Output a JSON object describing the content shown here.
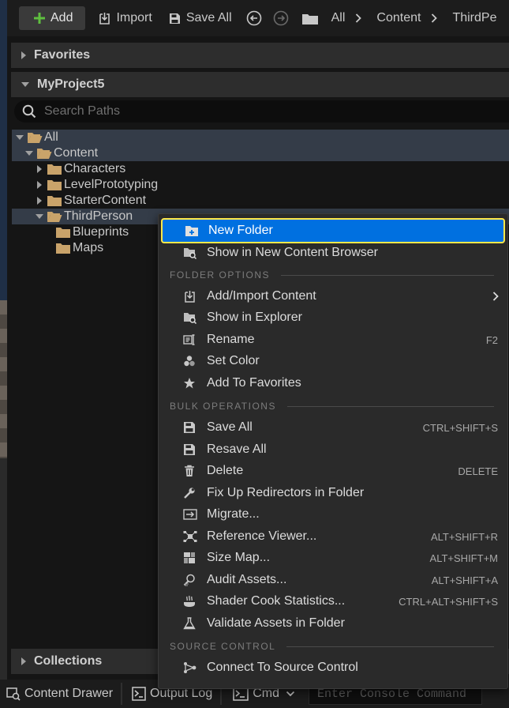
{
  "toolbar": {
    "add_label": "Add",
    "import_label": "Import",
    "save_all_label": "Save All",
    "breadcrumb": [
      "All",
      "Content",
      "ThirdPe"
    ]
  },
  "panel": {
    "favorites_label": "Favorites",
    "project_label": "MyProject5",
    "search_placeholder": "Search Paths",
    "collections_label": "Collections"
  },
  "tree": [
    {
      "label": "All",
      "depth": 0,
      "expanded": true,
      "selected": true
    },
    {
      "label": "Content",
      "depth": 1,
      "expanded": true,
      "selected": true
    },
    {
      "label": "Characters",
      "depth": 2,
      "expanded": false
    },
    {
      "label": "LevelPrototyping",
      "depth": 2,
      "expanded": false
    },
    {
      "label": "StarterContent",
      "depth": 2,
      "expanded": false
    },
    {
      "label": "ThirdPerson",
      "depth": 2,
      "expanded": true,
      "selected": true
    },
    {
      "label": "Blueprints",
      "depth": 3,
      "leaf": true
    },
    {
      "label": "Maps",
      "depth": 3,
      "leaf": true
    }
  ],
  "context_menu": {
    "items": [
      {
        "label": "New Folder",
        "icon": "new-folder-icon",
        "shortcut": "",
        "highlight": true
      },
      {
        "label": "Show in New Content Browser",
        "icon": "folder-search-icon",
        "shortcut": ""
      },
      {
        "section": "FOLDER OPTIONS"
      },
      {
        "label": "Add/Import Content",
        "icon": "import-icon",
        "shortcut": "",
        "submenu": true
      },
      {
        "label": "Show in Explorer",
        "icon": "folder-search-icon",
        "shortcut": ""
      },
      {
        "label": "Rename",
        "icon": "rename-icon",
        "shortcut": "F2"
      },
      {
        "label": "Set Color",
        "icon": "color-icon",
        "shortcut": ""
      },
      {
        "label": "Add To Favorites",
        "icon": "star-icon",
        "shortcut": ""
      },
      {
        "section": "BULK OPERATIONS"
      },
      {
        "label": "Save All",
        "icon": "save-icon",
        "shortcut": "CTRL+SHIFT+S"
      },
      {
        "label": "Resave All",
        "icon": "save-icon",
        "shortcut": ""
      },
      {
        "label": "Delete",
        "icon": "trash-icon",
        "shortcut": "DELETE"
      },
      {
        "label": "Fix Up Redirectors in Folder",
        "icon": "wrench-icon",
        "shortcut": ""
      },
      {
        "label": "Migrate...",
        "icon": "migrate-icon",
        "shortcut": ""
      },
      {
        "label": "Reference Viewer...",
        "icon": "reference-icon",
        "shortcut": "ALT+SHIFT+R"
      },
      {
        "label": "Size Map...",
        "icon": "size-map-icon",
        "shortcut": "ALT+SHIFT+M"
      },
      {
        "label": "Audit Assets...",
        "icon": "audit-icon",
        "shortcut": "ALT+SHIFT+A"
      },
      {
        "label": "Shader Cook Statistics...",
        "icon": "shader-icon",
        "shortcut": "CTRL+ALT+SHIFT+S"
      },
      {
        "label": "Validate Assets in Folder",
        "icon": "flask-icon",
        "shortcut": ""
      },
      {
        "section": "SOURCE CONTROL"
      },
      {
        "label": "Connect To Source Control",
        "icon": "source-control-icon",
        "shortcut": ""
      }
    ]
  },
  "bottombar": {
    "content_drawer_label": "Content Drawer",
    "output_log_label": "Output Log",
    "cmd_label": "Cmd",
    "console_placeholder": "Enter Console Command"
  },
  "colors": {
    "highlight_bg": "#0070e0",
    "highlight_border": "#ffe84a",
    "folder": "#c9a36a",
    "add_plus": "#5fbf3f"
  }
}
